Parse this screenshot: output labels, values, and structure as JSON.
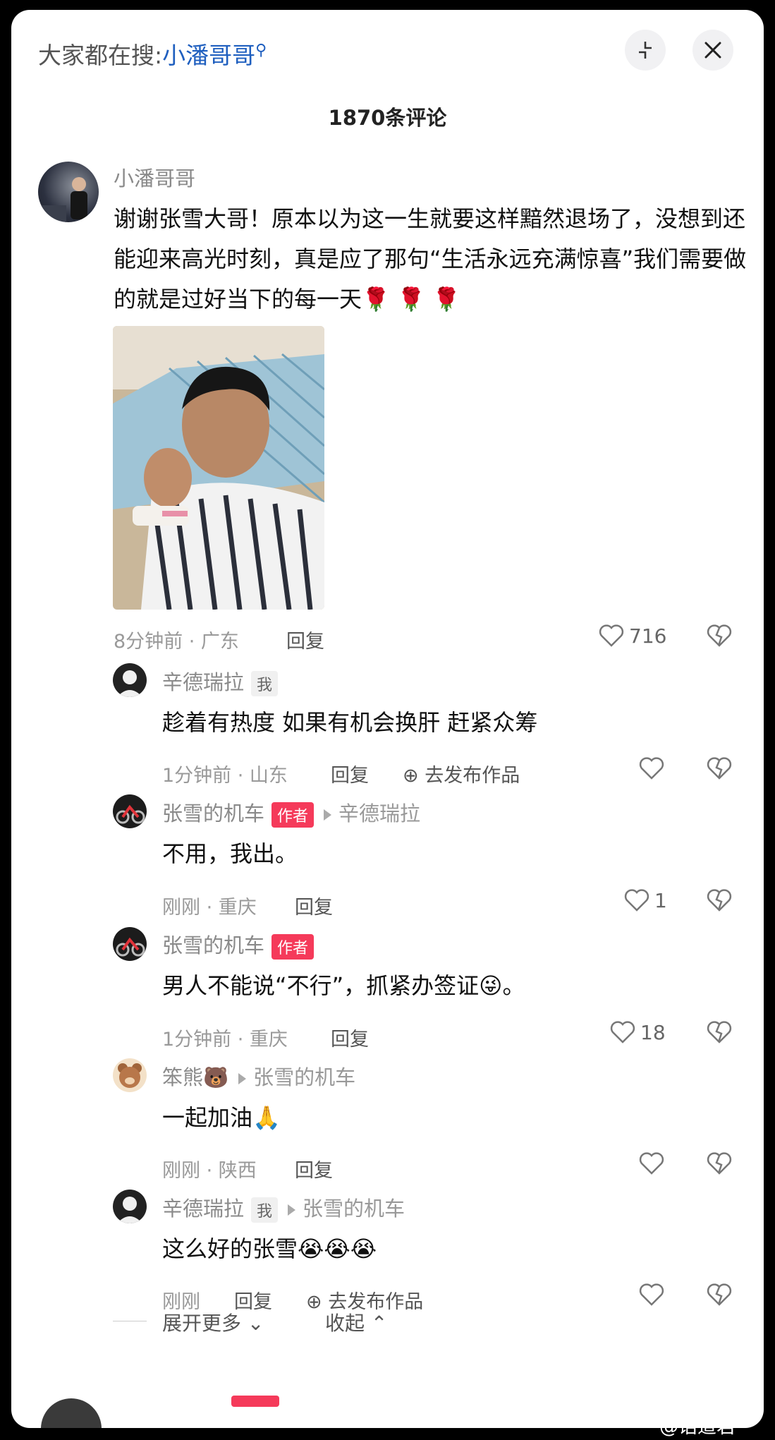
{
  "header": {
    "search_prefix": "大家都在搜:",
    "search_keyword": "小潘哥哥",
    "comment_count": "1870条评论"
  },
  "comments": [
    {
      "username": "小潘哥哥",
      "text": "谢谢张雪大哥！原本以为这一生就要这样黯然退场了，没想到还能迎来高光时刻，真是应了那句“生活永远充满惊喜”我们需要做的就是过好当下的每一天🌹 🌹 🌹",
      "meta": "8分钟前 · 广东",
      "reply": "回复",
      "likes": "716"
    }
  ],
  "replies": [
    {
      "username": "辛德瑞拉",
      "tag": "我",
      "reply_to": "",
      "text": "趁着有热度 如果有机会换肝 赶紧众筹",
      "meta": "1分钟前 · 山东",
      "reply": "回复",
      "publish": "去发布作品",
      "likes": ""
    },
    {
      "username": "张雪的机车",
      "tag": "作者",
      "reply_to": "辛德瑞拉",
      "text": "不用，我出。",
      "meta": "刚刚 · 重庆",
      "reply": "回复",
      "publish": "",
      "likes": "1"
    },
    {
      "username": "张雪的机车",
      "tag": "作者",
      "reply_to": "",
      "text": "男人不能说“不行”，抓紧办签证😜。",
      "meta": "1分钟前 · 重庆",
      "reply": "回复",
      "publish": "",
      "likes": "18"
    },
    {
      "username": "笨熊🐻",
      "tag": "",
      "reply_to": "张雪的机车",
      "text": "一起加油🙏",
      "meta": "刚刚 · 陕西",
      "reply": "回复",
      "publish": "",
      "likes": ""
    },
    {
      "username": "辛德瑞拉",
      "tag": "我",
      "reply_to": "张雪的机车",
      "text": "这么好的张雪😭😭😭",
      "meta": "刚刚",
      "reply": "回复",
      "publish": "去发布作品",
      "likes": ""
    }
  ],
  "footer": {
    "expand_more": "展开更多",
    "collapse": "收起"
  },
  "watermark": "@话道君",
  "colors": {
    "link": "#1f5fbf",
    "author_tag": "#f53a5a"
  }
}
